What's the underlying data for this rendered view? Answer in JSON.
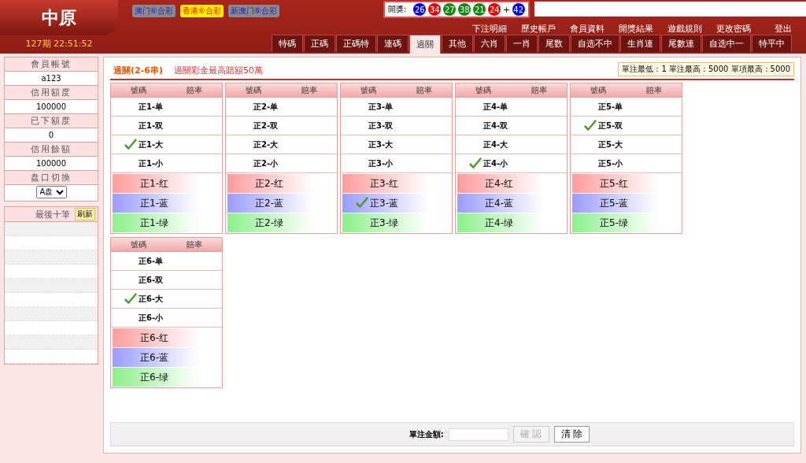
{
  "header": {
    "logo": "中原",
    "lotteries": [
      {
        "label": "澳门⑥合彩",
        "selected": false
      },
      {
        "label": "香港⑥合彩",
        "selected": true
      },
      {
        "label": "新澳门⑥合彩",
        "selected": false
      }
    ],
    "draw": {
      "label": "開獎:",
      "balls": [
        {
          "number": "26",
          "color": "#0000ee"
        },
        {
          "number": "34",
          "color": "#ee0000"
        },
        {
          "number": "27",
          "color": "#118811"
        },
        {
          "number": "38",
          "color": "#118811"
        },
        {
          "number": "21",
          "color": "#118811"
        },
        {
          "number": "24",
          "color": "#ee0000"
        }
      ],
      "plus": "+",
      "special": {
        "number": "42",
        "color": "#0000ee"
      }
    },
    "links": [
      "下注明細",
      "歷史帳戶",
      "會員資料",
      "開獎結果",
      "遊戲規則",
      "更改密碼",
      "登出"
    ],
    "period": "127期 22:51:52"
  },
  "tabs": [
    {
      "label": "特碼",
      "selected": false
    },
    {
      "label": "正碼",
      "selected": false
    },
    {
      "label": "正碼特",
      "selected": false
    },
    {
      "label": "連碼",
      "selected": false
    },
    {
      "label": "過關",
      "selected": true
    },
    {
      "label": "其他",
      "selected": false
    },
    {
      "label": "六肖",
      "selected": false
    },
    {
      "label": "一肖",
      "selected": false
    },
    {
      "label": "尾数",
      "selected": false
    },
    {
      "label": "自选不中",
      "selected": false
    },
    {
      "label": "生肖連",
      "selected": false
    },
    {
      "label": "尾數連",
      "selected": false
    },
    {
      "label": "自选中一",
      "selected": false
    },
    {
      "label": "特平中",
      "selected": false
    }
  ],
  "sidebar": {
    "account": [
      {
        "label": "會員帳號",
        "value": "a123"
      },
      {
        "label": "信用額度",
        "value": "100000"
      },
      {
        "label": "已下額度",
        "value": "0"
      },
      {
        "label": "信用餘額",
        "value": "100000"
      }
    ],
    "switch": {
      "label": "盘口切換",
      "value": "A盘"
    },
    "recent": {
      "title": "最後十筆",
      "refresh": "刷新"
    }
  },
  "main": {
    "title": "過關(2-6串)",
    "notice": "過關彩金最高賠額50萬",
    "limits": "單注最低：1  單注最高：5000  單項最高：5000",
    "groups": [
      {
        "columns": [
          "號碼",
          "賠率"
        ],
        "rows": [
          {
            "label": "正1-单",
            "kind": "plain",
            "checked": false
          },
          {
            "label": "正1-双",
            "kind": "plain",
            "checked": false
          },
          {
            "label": "正1-大",
            "kind": "plain",
            "checked": true
          },
          {
            "label": "正1-小",
            "kind": "plain",
            "checked": false
          },
          {
            "label": "正1-红",
            "kind": "red",
            "checked": false
          },
          {
            "label": "正1-蓝",
            "kind": "blue",
            "checked": false
          },
          {
            "label": "正1-绿",
            "kind": "green",
            "checked": false
          }
        ]
      },
      {
        "columns": [
          "號碼",
          "賠率"
        ],
        "rows": [
          {
            "label": "正2-单",
            "kind": "plain",
            "checked": false
          },
          {
            "label": "正2-双",
            "kind": "plain",
            "checked": false
          },
          {
            "label": "正2-大",
            "kind": "plain",
            "checked": false
          },
          {
            "label": "正2-小",
            "kind": "plain",
            "checked": false
          },
          {
            "label": "正2-红",
            "kind": "red",
            "checked": false
          },
          {
            "label": "正2-蓝",
            "kind": "blue",
            "checked": false
          },
          {
            "label": "正2-绿",
            "kind": "green",
            "checked": false
          }
        ]
      },
      {
        "columns": [
          "號碼",
          "賠率"
        ],
        "rows": [
          {
            "label": "正3-单",
            "kind": "plain",
            "checked": false
          },
          {
            "label": "正3-双",
            "kind": "plain",
            "checked": false
          },
          {
            "label": "正3-大",
            "kind": "plain",
            "checked": false
          },
          {
            "label": "正3-小",
            "kind": "plain",
            "checked": false
          },
          {
            "label": "正3-红",
            "kind": "red",
            "checked": false
          },
          {
            "label": "正3-蓝",
            "kind": "blue",
            "checked": true
          },
          {
            "label": "正3-绿",
            "kind": "green",
            "checked": false
          }
        ]
      },
      {
        "columns": [
          "號碼",
          "賠率"
        ],
        "rows": [
          {
            "label": "正4-单",
            "kind": "plain",
            "checked": false
          },
          {
            "label": "正4-双",
            "kind": "plain",
            "checked": false
          },
          {
            "label": "正4-大",
            "kind": "plain",
            "checked": false
          },
          {
            "label": "正4-小",
            "kind": "plain",
            "checked": true
          },
          {
            "label": "正4-红",
            "kind": "red",
            "checked": false
          },
          {
            "label": "正4-蓝",
            "kind": "blue",
            "checked": false
          },
          {
            "label": "正4-绿",
            "kind": "green",
            "checked": false
          }
        ]
      },
      {
        "columns": [
          "號碼",
          "賠率"
        ],
        "rows": [
          {
            "label": "正5-单",
            "kind": "plain",
            "checked": false
          },
          {
            "label": "正5-双",
            "kind": "plain",
            "checked": true
          },
          {
            "label": "正5-大",
            "kind": "plain",
            "checked": false
          },
          {
            "label": "正5-小",
            "kind": "plain",
            "checked": false
          },
          {
            "label": "正5-红",
            "kind": "red",
            "checked": false
          },
          {
            "label": "正5-蓝",
            "kind": "blue",
            "checked": false
          },
          {
            "label": "正5-绿",
            "kind": "green",
            "checked": false
          }
        ]
      },
      {
        "columns": [
          "號碼",
          "賠率"
        ],
        "rows": [
          {
            "label": "正6-单",
            "kind": "plain",
            "checked": false
          },
          {
            "label": "正6-双",
            "kind": "plain",
            "checked": false
          },
          {
            "label": "正6-大",
            "kind": "plain",
            "checked": true
          },
          {
            "label": "正6-小",
            "kind": "plain",
            "checked": false
          },
          {
            "label": "正6-红",
            "kind": "red",
            "checked": false
          },
          {
            "label": "正6-蓝",
            "kind": "blue",
            "checked": false
          },
          {
            "label": "正6-绿",
            "kind": "green",
            "checked": false
          }
        ]
      }
    ],
    "bet": {
      "label": "單注金額:",
      "confirm": {
        "label": "確 認",
        "disabled": true
      },
      "clear": {
        "label": "清 除",
        "disabled": false
      }
    }
  }
}
